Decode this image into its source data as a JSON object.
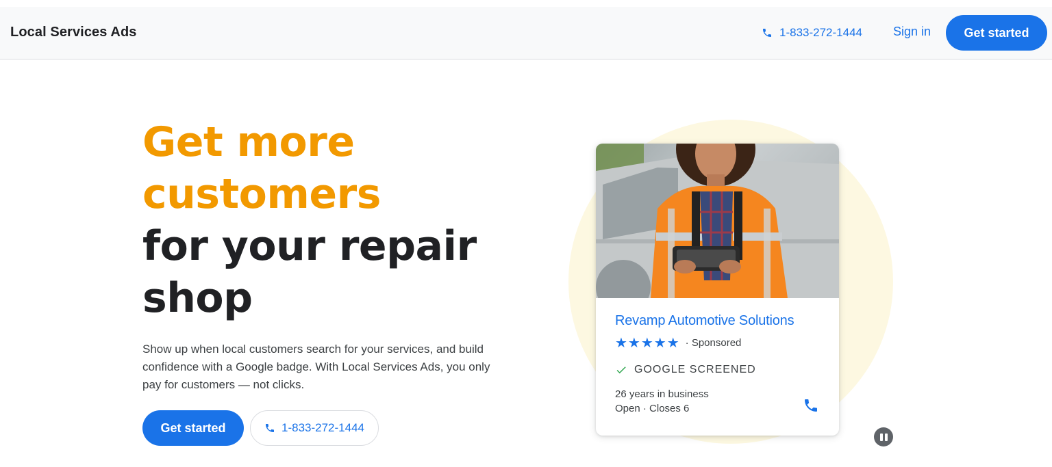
{
  "header": {
    "brand": "Local Services Ads",
    "phone": "1-833-272-1444",
    "sign_in": "Sign in",
    "cta": "Get started"
  },
  "hero": {
    "headline_accent_1": "Get more",
    "headline_accent_2": "customers",
    "headline_dark_1": "for your repair",
    "headline_dark_2": "shop",
    "subtext": "Show up when local customers search for your services, and build confidence with a Google badge. With Local Services Ads, you only pay for customers — not clicks.",
    "cta_primary": "Get started",
    "cta_phone": "1-833-272-1444"
  },
  "ad_card": {
    "business_name": "Revamp Automotive Solutions",
    "stars": "★★★★★",
    "sponsored": "· Sponsored",
    "badge": "GOOGLE SCREENED",
    "years": "26 years in business",
    "hours": "Open · Closes 6"
  },
  "icons": {
    "phone": "phone-icon",
    "check": "check-icon",
    "pause": "pause-icon"
  },
  "colors": {
    "accent_orange": "#f29900",
    "brand_blue": "#1a73e8",
    "circle_bg": "#fdf8e1",
    "check_green": "#34a853"
  }
}
